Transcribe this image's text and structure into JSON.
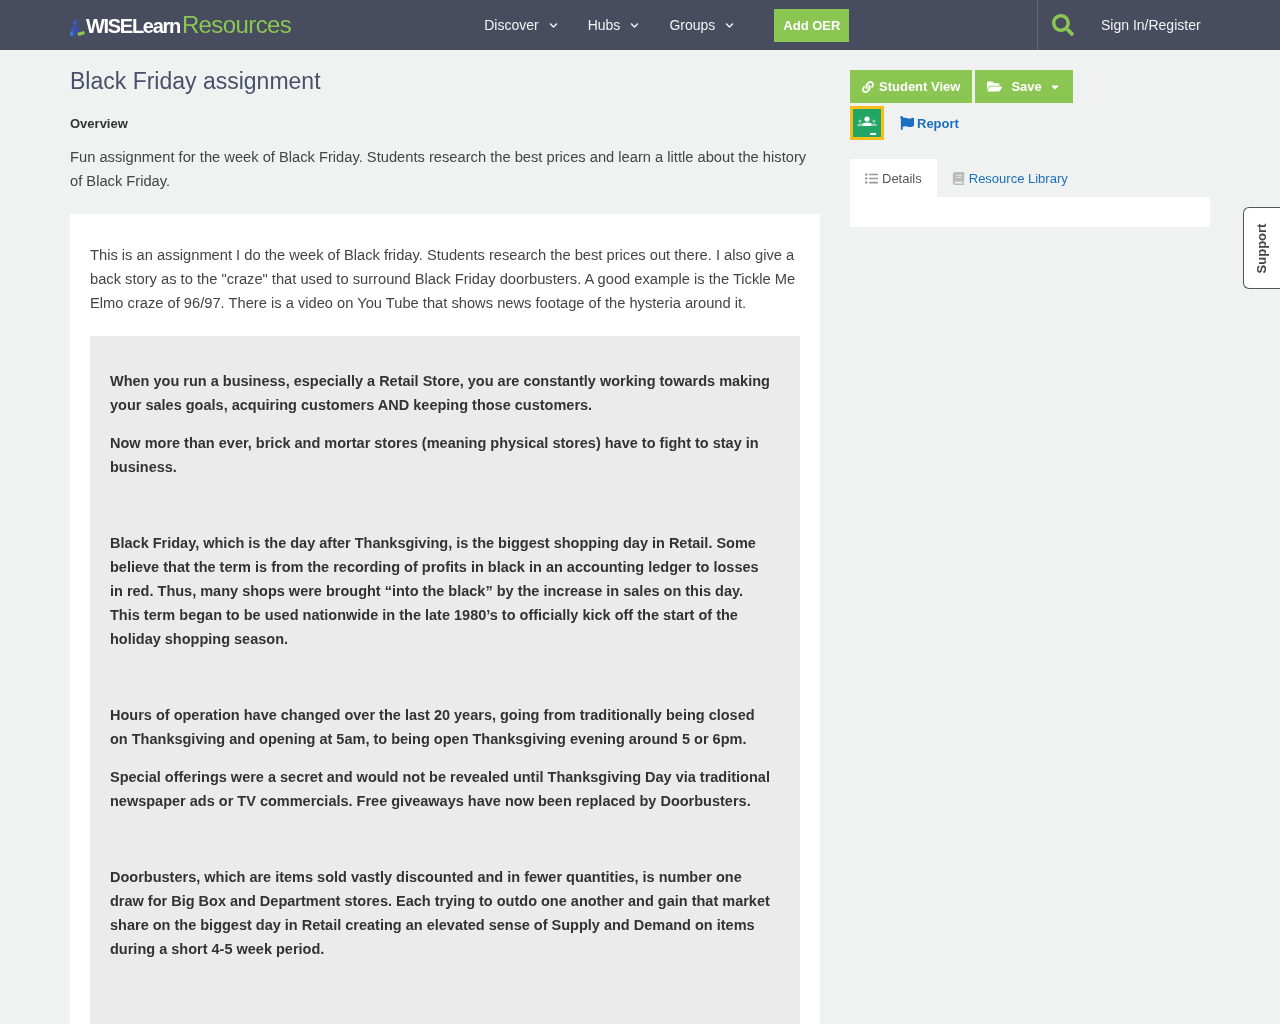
{
  "header": {
    "logo": {
      "part_1": "WISELearn",
      "part_2": "Resources"
    },
    "nav": [
      {
        "label": "Discover"
      },
      {
        "label": "Hubs"
      },
      {
        "label": "Groups"
      }
    ],
    "add_button": "Add OER",
    "sign_in": "Sign In/Register"
  },
  "resource": {
    "title": "Black Friday assignment",
    "overview_label": "Overview",
    "overview": "Fun assignment for the week of Black Friday. Students research the best prices and learn a little about the history of Black Friday.",
    "description": "This is an assignment I do the week of Black friday. Students research the best prices out there. I also give a back story as to the \"craze\" that used to surround Black Friday doorbusters. A good example is the Tickle Me Elmo craze of 96/97. There is a video on You Tube that shows news footage of the hysteria around it.",
    "sections": [
      {
        "paragraphs": [
          "When you run a business, especially a Retail Store, you are constantly working towards making your sales goals, acquiring customers AND keeping those customers.",
          "Now more than ever, brick and mortar stores (meaning physical stores) have to fight to stay in business."
        ]
      },
      {
        "paragraphs": [
          "Black Friday, which is the day after Thanksgiving, is the biggest shopping day in Retail. Some believe that the term is from the recording of profits in black in an accounting ledger to losses in red. Thus, many shops were brought “into the black” by the increase in sales on this day. This term began to be used nationwide in the late 1980’s to officially kick off the start of the holiday shopping season."
        ]
      },
      {
        "paragraphs": [
          "Hours of operation have changed over the last 20 years, going from traditionally being closed on Thanksgiving and opening at 5am, to being open Thanksgiving evening around 5 or 6pm.",
          "Special offerings were a secret and would not be revealed until Thanksgiving Day via traditional newspaper ads or TV commercials. Free giveaways have now been replaced by Doorbusters."
        ]
      },
      {
        "paragraphs": [
          "Doorbusters, which are items sold vastly discounted and in fewer quantities, is number one draw for Big Box and Department stores. Each trying to outdo one another and gain that market share on the biggest day in Retail creating an elevated sense of Supply and Demand on items during a short 4-5 week period."
        ]
      }
    ]
  },
  "sidebar": {
    "buttons": [
      {
        "label": "Student View",
        "kind": "link"
      },
      {
        "label": "Save",
        "kind": "dropdown"
      }
    ],
    "report": "Report",
    "tabs": [
      {
        "label": "Details",
        "selected": true
      },
      {
        "label": "Resource Library",
        "selected": false
      }
    ]
  },
  "support_tab": "Support"
}
